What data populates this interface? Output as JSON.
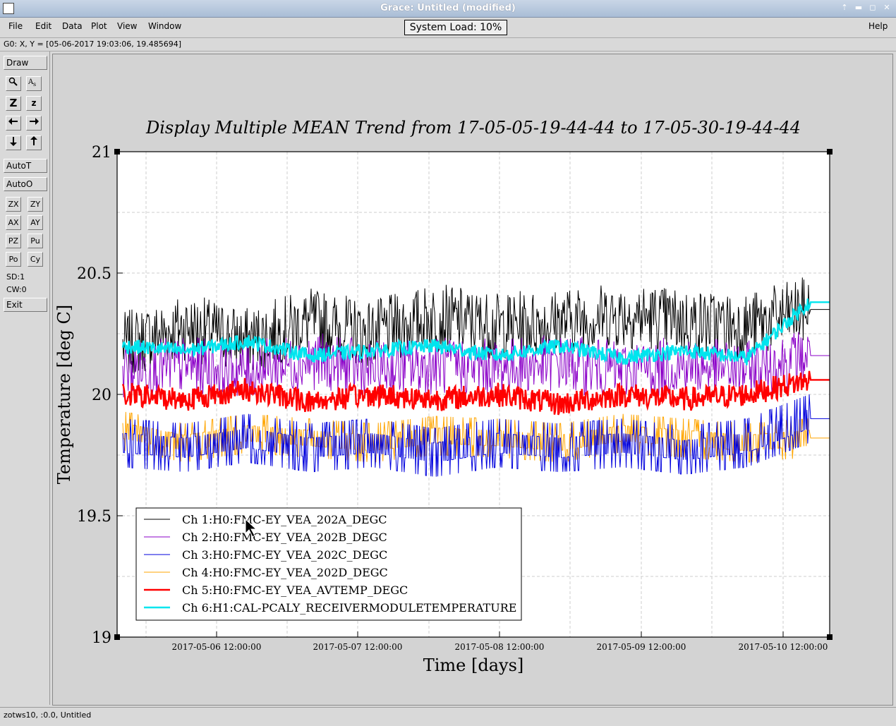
{
  "window": {
    "title": "Grace: Untitled (modified)"
  },
  "menu": {
    "items": [
      {
        "label": "File",
        "u": "F"
      },
      {
        "label": "Edit",
        "u": "E"
      },
      {
        "label": "Data",
        "u": "D"
      },
      {
        "label": "Plot",
        "u": "P"
      },
      {
        "label": "View",
        "u": "V"
      },
      {
        "label": "Window",
        "u": "W"
      }
    ],
    "help": "Help"
  },
  "system_load": "System Load: 10%",
  "coord_readout": "G0: X, Y = [05-06-2017 19:03:06, 19.485694]",
  "toolbox": {
    "draw": "Draw",
    "icon_buttons": [
      {
        "name": "zoom-icon",
        "glyph": "🔍"
      },
      {
        "name": "text-icon",
        "glyph": "A"
      },
      {
        "name": "zoom-z-icon",
        "glyph": "Z"
      },
      {
        "name": "zoom-z-small-icon",
        "glyph": "z"
      },
      {
        "name": "arrow-left-icon",
        "glyph": "←"
      },
      {
        "name": "arrow-right-icon",
        "glyph": "→"
      },
      {
        "name": "arrow-down-icon",
        "glyph": "↓"
      },
      {
        "name": "arrow-up-icon",
        "glyph": "↑"
      }
    ],
    "autot": "AutoT",
    "autoo": "AutoO",
    "small_buttons": [
      "ZX",
      "ZY",
      "AX",
      "AY",
      "PZ",
      "Pu",
      "Po",
      "Cy"
    ],
    "sd": "SD:1",
    "cw": "CW:0",
    "exit": "Exit"
  },
  "status": "zotws10, :0.0, Untitled",
  "chart_data": {
    "type": "line",
    "title": "Display Multiple MEAN Trend from 17-05-05-19-44-44 to 17-05-30-19-44-44",
    "xlabel": "Time [days]",
    "ylabel": "Temperature [deg C]",
    "ylim": [
      19,
      21
    ],
    "y_ticks": [
      "19",
      "19.5",
      "20",
      "20.5",
      "21"
    ],
    "x_tick_labels": [
      "2017-05-06 12:00:00",
      "2017-05-07 12:00:00",
      "2017-05-08 12:00:00",
      "2017-05-09 12:00:00",
      "2017-05-10 12:00:00"
    ],
    "grid": true,
    "legend_position": "bottom-left",
    "series": [
      {
        "name": "Ch 1:H0:FMC-EY_VEA_202A_DEGC",
        "color": "#000000",
        "base": 20.22,
        "amp": 0.14,
        "values": [
          20.2,
          20.28,
          20.22,
          20.3,
          20.25,
          20.32,
          20.28,
          20.3,
          20.33,
          20.3,
          20.28,
          20.35
        ]
      },
      {
        "name": "Ch 2:H0:FMC-EY_VEA_202B_DEGC",
        "color": "#8b00c8",
        "base": 20.1,
        "amp": 0.12,
        "values": [
          20.1,
          20.12,
          20.1,
          20.14,
          20.1,
          20.12,
          20.11,
          20.13,
          20.1,
          20.12,
          20.1,
          20.16
        ]
      },
      {
        "name": "Ch 3:H0:FMC-EY_VEA_202C_DEGC",
        "color": "#0000dd",
        "base": 19.78,
        "amp": 0.1,
        "values": [
          19.8,
          19.78,
          19.82,
          19.78,
          19.8,
          19.76,
          19.8,
          19.78,
          19.8,
          19.77,
          19.8,
          19.9
        ]
      },
      {
        "name": "Ch 4:H0:FMC-EY_VEA_202D_DEGC",
        "color": "#ffa500",
        "base": 19.82,
        "amp": 0.08,
        "values": [
          19.85,
          19.8,
          19.84,
          19.82,
          19.8,
          19.83,
          19.82,
          19.8,
          19.84,
          19.82,
          19.8,
          19.82
        ]
      },
      {
        "name": "Ch 5:H0:FMC-EY_VEA_AVTEMP_DEGC",
        "color": "#ff0000",
        "base": 19.99,
        "amp": 0.05,
        "values": [
          20.0,
          19.98,
          20.02,
          19.97,
          20.0,
          19.98,
          20.0,
          19.96,
          20.0,
          19.98,
          20.0,
          20.06
        ]
      },
      {
        "name": "Ch 6:H1:CAL-PCALY_RECEIVERMODULETEMPERATURE",
        "color": "#00e5ee",
        "base": 20.17,
        "amp": 0.03,
        "values": [
          20.2,
          20.18,
          20.22,
          20.16,
          20.18,
          20.2,
          20.16,
          20.2,
          20.15,
          20.18,
          20.15,
          20.38
        ]
      }
    ]
  }
}
